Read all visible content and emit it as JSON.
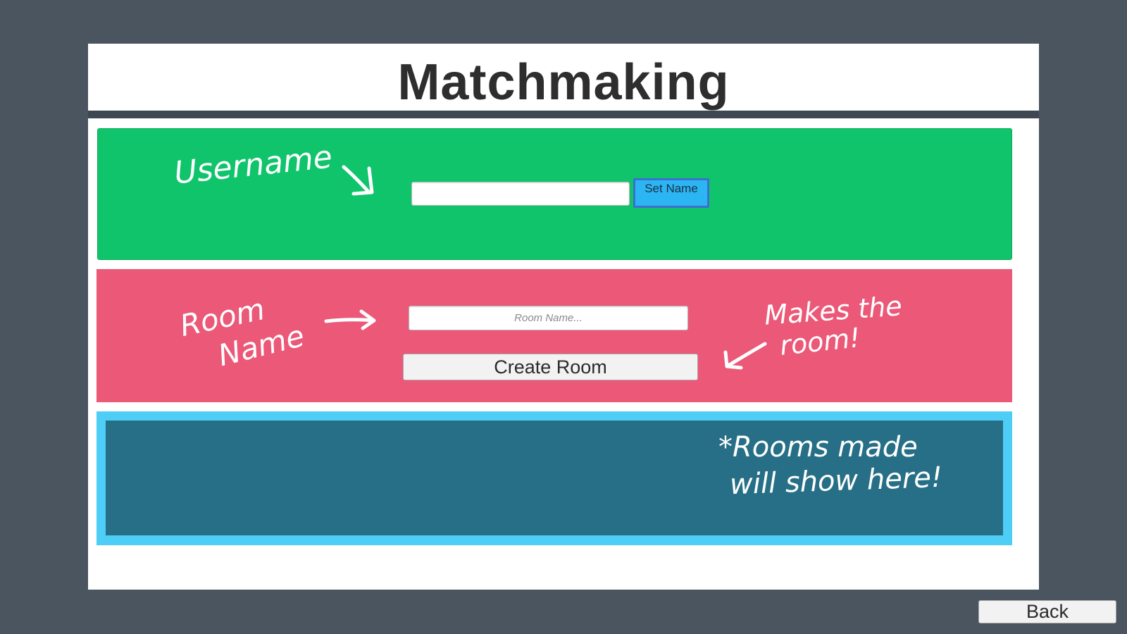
{
  "title": "Matchmaking",
  "username": {
    "annotation": "Username",
    "value": "",
    "button_label": "Set Name"
  },
  "room": {
    "annotation_line1": "Room",
    "annotation_line2": "Name",
    "placeholder": "Room Name...",
    "create_label": "Create Room",
    "hint_line1": "Makes  the",
    "hint_line2": "room!"
  },
  "rooms_list": {
    "note_line1": "*Rooms  made",
    "note_line2": "will  show  here!"
  },
  "back_label": "Back",
  "colors": {
    "background": "#4a5560",
    "user_section": "#0fc46b",
    "room_section": "#eb5878",
    "list_border": "#4ecdf7",
    "list_fill": "#276f86",
    "set_name_button": "#2bb6f3"
  }
}
